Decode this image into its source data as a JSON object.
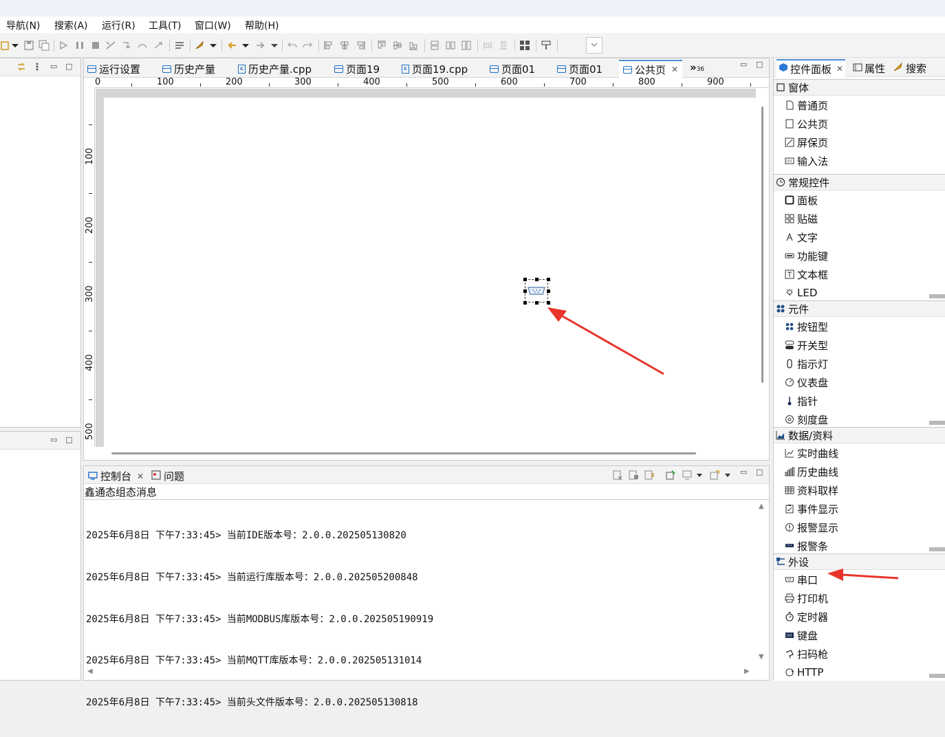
{
  "menu": [
    "导航(N)",
    "搜索(A)",
    "运行(R)",
    "工具(T)",
    "窗口(W)",
    "帮助(H)"
  ],
  "editor": {
    "tabs": [
      {
        "label": "运行设置",
        "icon": "page-icon"
      },
      {
        "label": "历史产量",
        "icon": "page-icon"
      },
      {
        "label": "历史产量.cpp",
        "icon": "cpp-file-icon"
      },
      {
        "label": "页面19",
        "icon": "page-icon"
      },
      {
        "label": "页面19.cpp",
        "icon": "cpp-file-icon"
      },
      {
        "label": "页面01",
        "icon": "page-icon"
      },
      {
        "label": "页面01",
        "icon": "page-icon"
      },
      {
        "label": "公共页",
        "icon": "page-icon",
        "active": true
      }
    ],
    "overflow_label": "»",
    "overflow_count": "36",
    "ruler_h": [
      "0",
      "100",
      "200",
      "300",
      "400",
      "500",
      "600",
      "700",
      "800",
      "900"
    ],
    "ruler_v": [
      "100",
      "200",
      "300",
      "400",
      "500"
    ]
  },
  "console": {
    "tabs": [
      "控制台",
      "问题"
    ],
    "name": "鑫通态组态消息",
    "lines": [
      "2025年6月8日 下午7:33:45> 当前IDE版本号：2.0.0.202505130820",
      "2025年6月8日 下午7:33:45> 当前运行库版本号：2.0.0.202505200848",
      "2025年6月8日 下午7:33:45> 当前MODBUS库版本号：2.0.0.202505190919",
      "2025年6月8日 下午7:33:45> 当前MQTT库版本号：2.0.0.202505131014",
      "2025年6月8日 下午7:33:45> 当前头文件版本号：2.0.0.202505130818"
    ]
  },
  "palette": {
    "tabs": [
      "控件面板",
      "属性",
      "搜索"
    ],
    "categories": [
      {
        "label": "窗体",
        "icon": "window-icon",
        "items": [
          {
            "label": "普通页",
            "icon": "page-icon"
          },
          {
            "label": "公共页",
            "icon": "page-icon"
          },
          {
            "label": "屏保页",
            "icon": "screensaver-icon"
          },
          {
            "label": "输入法",
            "icon": "keyboard-icon"
          }
        ]
      },
      {
        "label": "常规控件",
        "icon": "clock-icon",
        "items": [
          {
            "label": "面板",
            "icon": "panel-icon"
          },
          {
            "label": "贴磁",
            "icon": "tiles-icon"
          },
          {
            "label": "文字",
            "icon": "text-icon"
          },
          {
            "label": "功能键",
            "icon": "function-key-icon"
          },
          {
            "label": "文本框",
            "icon": "textbox-icon"
          },
          {
            "label": "LED",
            "icon": "led-icon"
          }
        ]
      },
      {
        "label": "元件",
        "icon": "components-icon",
        "items": [
          {
            "label": "按钮型",
            "icon": "button-type-icon"
          },
          {
            "label": "开关型",
            "icon": "switch-icon"
          },
          {
            "label": "指示灯",
            "icon": "indicator-icon"
          },
          {
            "label": "仪表盘",
            "icon": "gauge-icon"
          },
          {
            "label": "指针",
            "icon": "pointer-icon"
          },
          {
            "label": "刻度盘",
            "icon": "dial-icon"
          }
        ]
      },
      {
        "label": "数据/资料",
        "icon": "area-chart-icon",
        "items": [
          {
            "label": "实时曲线",
            "icon": "line-chart-icon"
          },
          {
            "label": "历史曲线",
            "icon": "bar-chart-icon"
          },
          {
            "label": "资料取样",
            "icon": "table-icon"
          },
          {
            "label": "事件显示",
            "icon": "clipboard-icon"
          },
          {
            "label": "报警显示",
            "icon": "alert-icon"
          },
          {
            "label": "报警条",
            "icon": "alarm-bar-icon"
          }
        ]
      },
      {
        "label": "外设",
        "icon": "peripheral-icon",
        "items": [
          {
            "label": "串口",
            "icon": "serial-port-icon"
          },
          {
            "label": "打印机",
            "icon": "printer-icon"
          },
          {
            "label": "定时器",
            "icon": "timer-icon"
          },
          {
            "label": "键盘",
            "icon": "keyboard-icon"
          },
          {
            "label": "扫码枪",
            "icon": "scanner-icon"
          },
          {
            "label": "HTTP",
            "icon": "http-icon"
          }
        ]
      }
    ]
  },
  "colors": {
    "accent": "#1f6fc4",
    "annotation_arrow": "#e8342b",
    "selection_handle": "#000000"
  }
}
